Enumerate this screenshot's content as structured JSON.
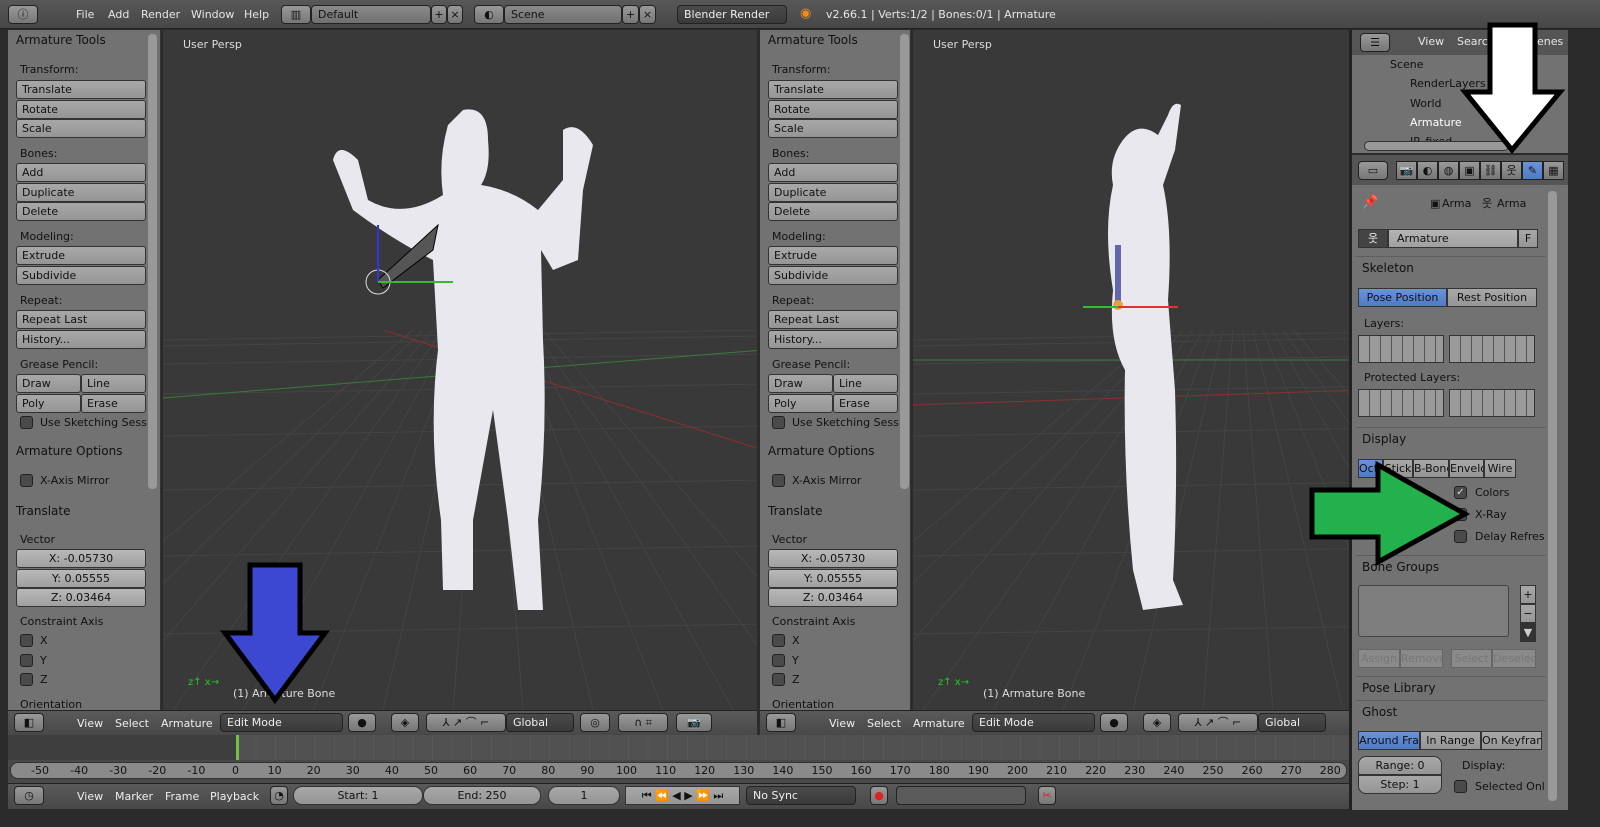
{
  "topbar": {
    "menus": [
      "File",
      "Add",
      "Render",
      "Window",
      "Help"
    ],
    "layout": "Default",
    "scene": "Scene",
    "engine": "Blender Render",
    "info": "v2.66.1 | Verts:1/2 | Bones:0/1 | Armature"
  },
  "shelf": {
    "title": "Armature Tools",
    "transform": "Transform:",
    "translate": "Translate",
    "rotate": "Rotate",
    "scale": "Scale",
    "bones": "Bones:",
    "add": "Add",
    "duplicate": "Duplicate",
    "delete": "Delete",
    "modeling": "Modeling:",
    "extrude": "Extrude",
    "subdivide": "Subdivide",
    "repeat": "Repeat:",
    "repeat_last": "Repeat Last",
    "history": "History...",
    "grease": "Grease Pencil:",
    "draw": "Draw",
    "line": "Line",
    "poly": "Poly",
    "erase": "Erase",
    "sketch": "Use Sketching Sessi",
    "options_title": "Armature Options",
    "xmirror": "X-Axis Mirror",
    "op_title": "Translate",
    "vector": "Vector",
    "vx": "X: -0.05730",
    "vy": "Y: 0.05555",
    "vz": "Z: 0.03464",
    "constraint": "Constraint Axis",
    "cx": "X",
    "cy": "Y",
    "cz": "Z",
    "orientation": "Orientation"
  },
  "viewport": {
    "label": "User Persp",
    "status": "(1) Armature Bone"
  },
  "header3d": {
    "menus": [
      "View",
      "Select",
      "Armature"
    ],
    "mode": "Edit Mode",
    "orientation": "Global"
  },
  "outliner": {
    "menus": [
      "View",
      "Searc",
      "Scenes"
    ],
    "items": [
      "Scene",
      "RenderLayers",
      "World",
      "Armature",
      "IP_fixed"
    ]
  },
  "properties": {
    "breadcrumb": [
      "Arma",
      "Arma"
    ],
    "datablock": "Armature",
    "fake": "F",
    "skeleton": "Skeleton",
    "pose_position": "Pose Position",
    "rest_position": "Rest Position",
    "layers": "Layers:",
    "protected_layers": "Protected Layers:",
    "display": "Display",
    "display_types": [
      "Octa",
      "Stick",
      "B-Bone",
      "Envelo",
      "Wire"
    ],
    "colors": "Colors",
    "xray": "X-Ray",
    "delay": "Delay Refres",
    "bone_groups": "Bone Groups",
    "assign": "Assign",
    "remove": "Remove",
    "select": "Select",
    "deselect": "Deselec",
    "pose_library": "Pose Library",
    "ghost": "Ghost",
    "ghost_types": [
      "Around Fra",
      "In Range",
      "On Keyfram"
    ],
    "range": "Range: 0",
    "step": "Step: 1",
    "display_label": "Display:",
    "selected_only": "Selected Onl",
    "checks": {
      "colors": true,
      "xray": true,
      "delay": false,
      "selected_only": false
    }
  },
  "timeline": {
    "ticks": [
      "-50",
      "-40",
      "-30",
      "-20",
      "-10",
      "0",
      "10",
      "20",
      "30",
      "40",
      "50",
      "60",
      "70",
      "80",
      "90",
      "100",
      "110",
      "120",
      "130",
      "140",
      "150",
      "160",
      "170",
      "180",
      "190",
      "200",
      "210",
      "220",
      "230",
      "240",
      "250",
      "260",
      "270",
      "280"
    ],
    "current_frame_value": 0
  },
  "bottombar": {
    "menus": [
      "View",
      "Marker",
      "Frame",
      "Playback"
    ],
    "start": "Start: 1",
    "end": "End: 250",
    "frame": "1",
    "sync": "No Sync"
  },
  "colors": {
    "accent": "#5680c2",
    "blue_arrow": "#3c48d2",
    "green_arrow": "#22b14c",
    "frame_line": "#6ec340"
  }
}
